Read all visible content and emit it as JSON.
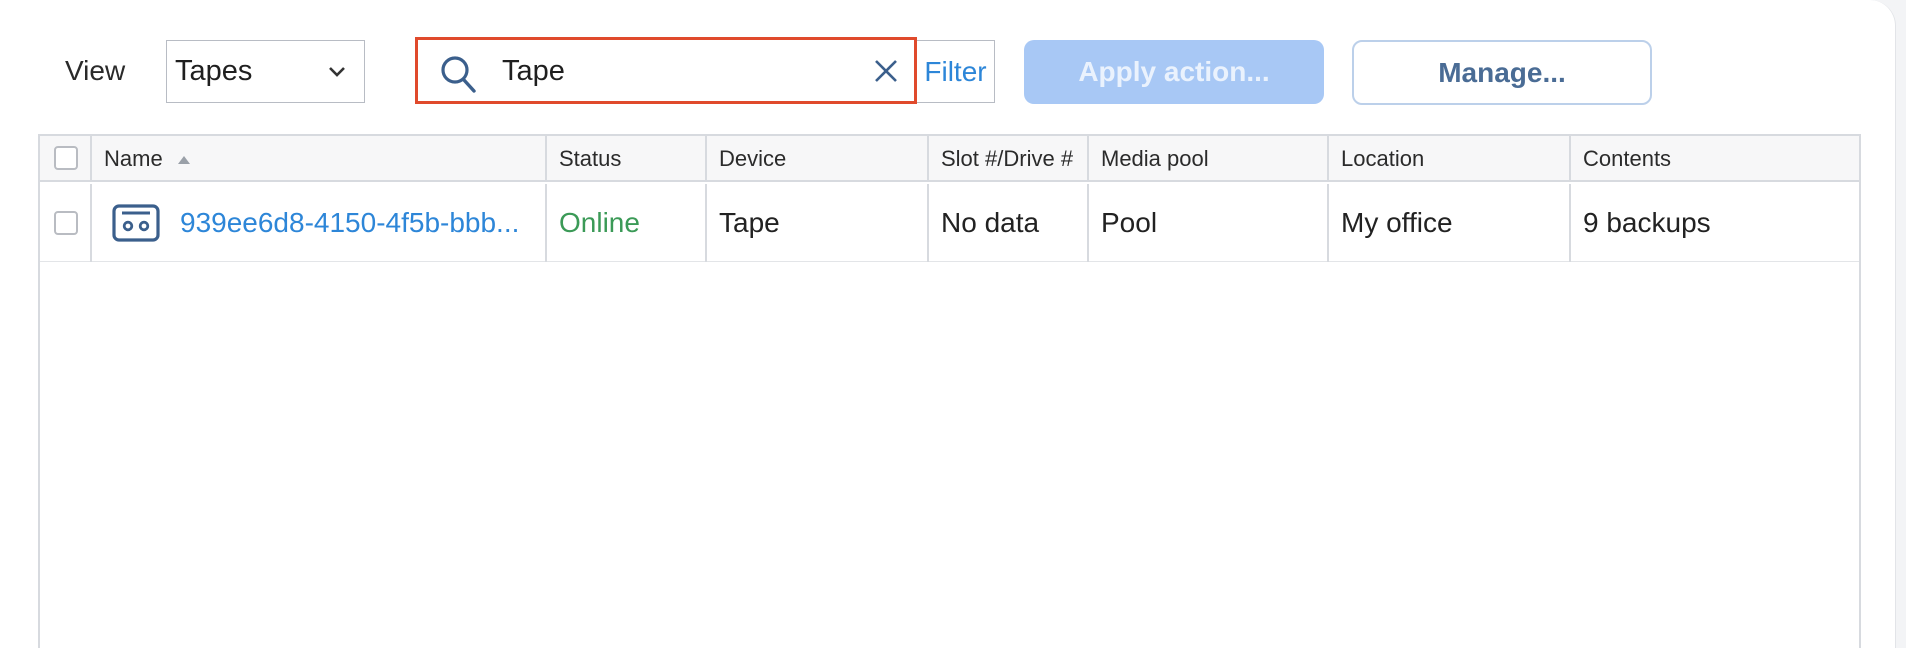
{
  "toolbar": {
    "view_label": "View",
    "view_value": "Tapes",
    "search_value": "Tape",
    "filter_label": "Filter",
    "apply_label": "Apply action...",
    "manage_label": "Manage..."
  },
  "table": {
    "columns": [
      "Name",
      "Status",
      "Device",
      "Slot #/Drive #",
      "Media pool",
      "Location",
      "Contents"
    ],
    "rows": [
      {
        "name": "939ee6d8-4150-4f5b-bbb...",
        "status": "Online",
        "device": "Tape",
        "slot": "No data",
        "media_pool": "Pool",
        "location": "My office",
        "contents": "9 backups",
        "icon": "tape-cassette-icon"
      }
    ]
  },
  "colors": {
    "accent": "#2d86d8",
    "online": "#3b9a57",
    "search_highlight": "#e04a2c",
    "apply_disabled": "#a8c8f5"
  }
}
